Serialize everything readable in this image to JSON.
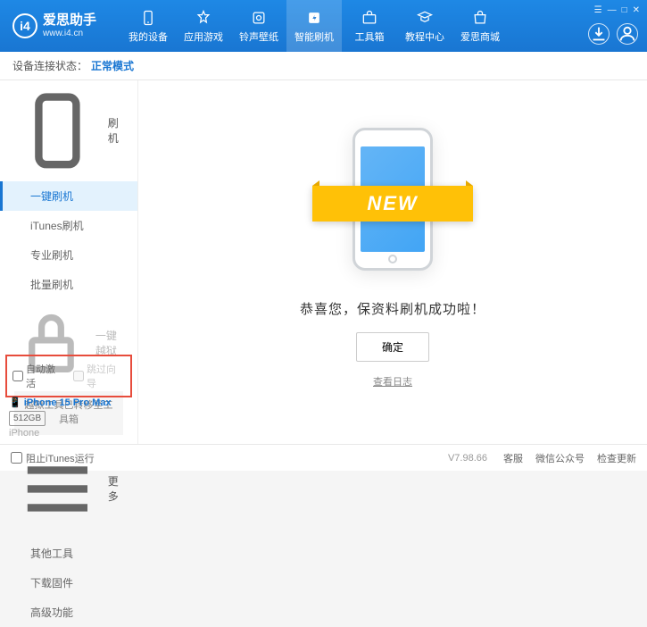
{
  "header": {
    "logo_text": "爱思助手",
    "logo_sub": "www.i4.cn",
    "nav": [
      "我的设备",
      "应用游戏",
      "铃声壁纸",
      "智能刷机",
      "工具箱",
      "教程中心",
      "爱思商城"
    ],
    "active_nav": 3,
    "window_controls": [
      "☰",
      "—",
      "□",
      "✕"
    ]
  },
  "status": {
    "label": "设备连接状态：",
    "mode": "正常模式"
  },
  "sidebar": {
    "group_flash": {
      "label": "刷机",
      "items": [
        "一键刷机",
        "iTunes刷机",
        "专业刷机",
        "批量刷机"
      ],
      "active": 0
    },
    "group_jb": {
      "label": "一键越狱",
      "note": "越狱工具已转移至工具箱"
    },
    "group_more": {
      "label": "更多",
      "items": [
        "其他工具",
        "下载固件",
        "高级功能"
      ]
    },
    "checks": {
      "auto_activate": "自动激活",
      "skip_guide": "跳过向导"
    },
    "device": {
      "name": "iPhone 15 Pro Max",
      "storage": "512GB",
      "type": "iPhone"
    }
  },
  "main": {
    "ribbon": "NEW",
    "message": "恭喜您，保资料刷机成功啦！",
    "ok_btn": "确定",
    "log_link": "查看日志"
  },
  "footer": {
    "block_itunes": "阻止iTunes运行",
    "version": "V7.98.66",
    "links": [
      "客服",
      "微信公众号",
      "检查更新"
    ]
  }
}
